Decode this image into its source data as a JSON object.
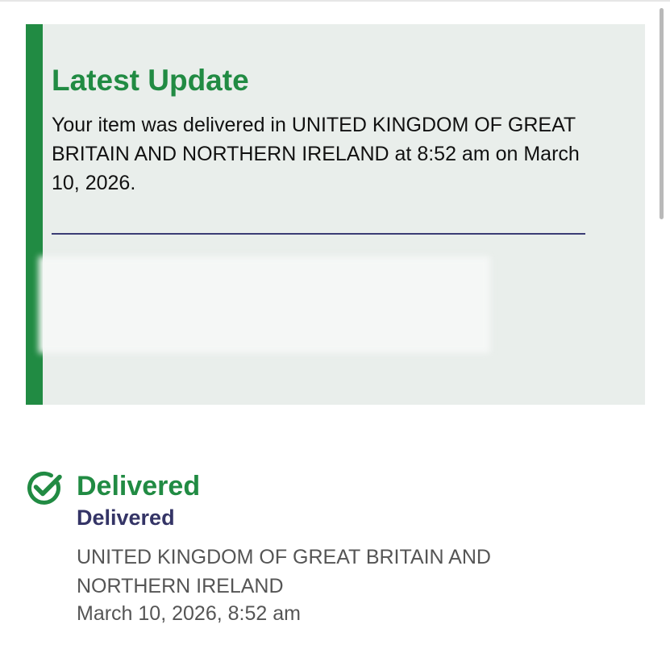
{
  "latest_update": {
    "title": "Latest Update",
    "message": "Your item was delivered in UNITED KINGDOM OF GREAT BRITAIN AND NORTHERN IRELAND at 8:52 am on March 10, 2026."
  },
  "status": {
    "icon": "check-circle-icon",
    "title": "Delivered",
    "subtitle": "Delivered",
    "location": "UNITED KINGDOM OF GREAT BRITAIN AND NORTHERN IRELAND",
    "timestamp": "March 10, 2026, 8:52 am"
  },
  "colors": {
    "accent_green": "#218b43",
    "card_background": "#e9eeeb",
    "divider_navy": "#3b3d75",
    "status_navy": "#343466",
    "muted_text": "#555555"
  }
}
